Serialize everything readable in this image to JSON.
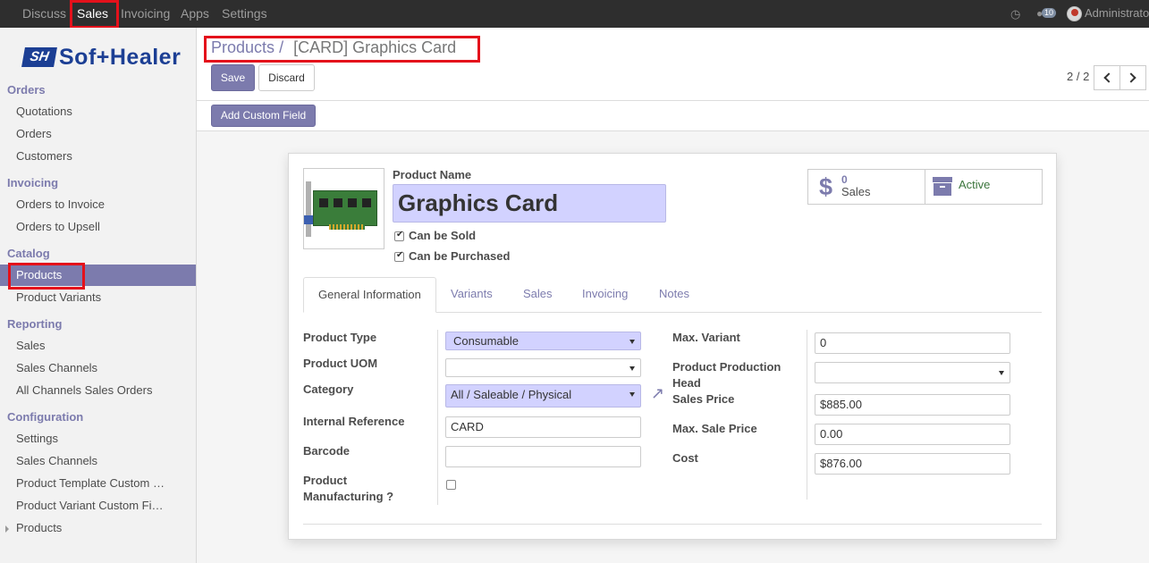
{
  "topbar": {
    "menus": [
      "Discuss",
      "Sales",
      "Invoicing",
      "Apps",
      "Settings"
    ],
    "active_menu": "Sales",
    "badge": "10",
    "user": "Administrator"
  },
  "sidebar": {
    "logo_mark": "SH",
    "logo_text": "Sof+Healer",
    "sections": [
      {
        "title": "Orders",
        "items": [
          "Quotations",
          "Orders",
          "Customers"
        ]
      },
      {
        "title": "Invoicing",
        "items": [
          "Orders to Invoice",
          "Orders to Upsell"
        ]
      },
      {
        "title": "Catalog",
        "items": [
          "Products",
          "Product Variants"
        ]
      },
      {
        "title": "Reporting",
        "items": [
          "Sales",
          "Sales Channels",
          "All Channels Sales Orders"
        ]
      },
      {
        "title": "Configuration",
        "items": [
          "Settings",
          "Sales Channels",
          "Product Template Custom …",
          "Product Variant Custom Fi…",
          "Products"
        ]
      }
    ],
    "active_item": "Products"
  },
  "breadcrumb": {
    "parent": "Products",
    "separator": "/",
    "current": "[CARD] Graphics Card"
  },
  "buttons": {
    "save": "Save",
    "discard": "Discard",
    "add_custom_field": "Add Custom Field"
  },
  "pager": {
    "text": "2 / 2"
  },
  "form": {
    "product_name_label": "Product Name",
    "product_name": "Graphics Card",
    "can_be_sold": "Can be Sold",
    "can_be_purchased": "Can be Purchased",
    "smart_sales_value": "0",
    "smart_sales_label": "Sales",
    "smart_active_label": "Active",
    "tabs": [
      "General Information",
      "Variants",
      "Sales",
      "Invoicing",
      "Notes"
    ],
    "left_fields": {
      "product_type": {
        "label": "Product Type",
        "value": "Consumable"
      },
      "product_uom": {
        "label": "Product UOM",
        "value": ""
      },
      "category": {
        "label": "Category",
        "value": "All / Saleable / Physical"
      },
      "internal_reference": {
        "label": "Internal Reference",
        "value": "CARD"
      },
      "barcode": {
        "label": "Barcode",
        "value": ""
      },
      "product_manufacturing_1": "Product",
      "product_manufacturing_2": "Manufacturing ?"
    },
    "right_fields": {
      "max_variant": {
        "label": "Max. Variant",
        "value": "0"
      },
      "production_head_1": "Product Production",
      "production_head_2": "Head",
      "sales_price": {
        "label": "Sales Price",
        "value": "$885.00"
      },
      "max_sale_price": {
        "label": "Max. Sale Price",
        "value": "0.00"
      },
      "cost": {
        "label": "Cost",
        "value": "$876.00"
      }
    }
  },
  "colors": {
    "accent": "#7c7bad",
    "highlight": "#e4111b",
    "topbar": "#2e2e2e"
  }
}
